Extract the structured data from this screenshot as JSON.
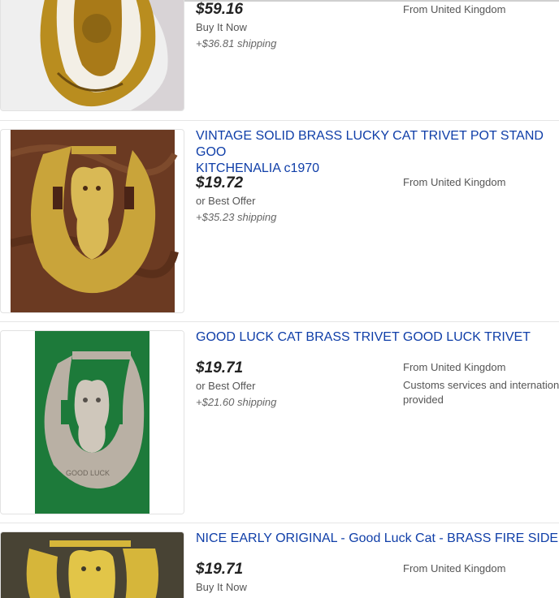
{
  "items": [
    {
      "price": "$59.16",
      "format": "Buy It Now",
      "shipping": "+$36.81 shipping",
      "location": "From United Kingdom"
    },
    {
      "title_line1": "VINTAGE SOLID BRASS LUCKY CAT TRIVET POT STAND GOO",
      "title_line2": "KITCHENALIA c1970",
      "price": "$19.72",
      "format": "or Best Offer",
      "shipping": "+$35.23 shipping",
      "location": "From United Kingdom"
    },
    {
      "title_line1": "GOOD LUCK CAT BRASS TRIVET GOOD LUCK TRIVET",
      "price": "$19.71",
      "format": "or Best Offer",
      "shipping": "+$21.60 shipping",
      "location": "From United Kingdom",
      "extra_line1": "Customs services and internation",
      "extra_line2": "provided"
    },
    {
      "title_line1": "NICE EARLY ORIGINAL - Good Luck Cat - BRASS FIRE SIDE T",
      "price": "$19.71",
      "format": "Buy It Now",
      "location": "From United Kingdom"
    }
  ],
  "image_text": {
    "good_luck": "GOOD LUCK"
  },
  "colors": {
    "title_link": "#0f3ea8",
    "brass": "#c9a43a",
    "felt_green": "#1d7a3a",
    "wood": "#6b3a22"
  }
}
